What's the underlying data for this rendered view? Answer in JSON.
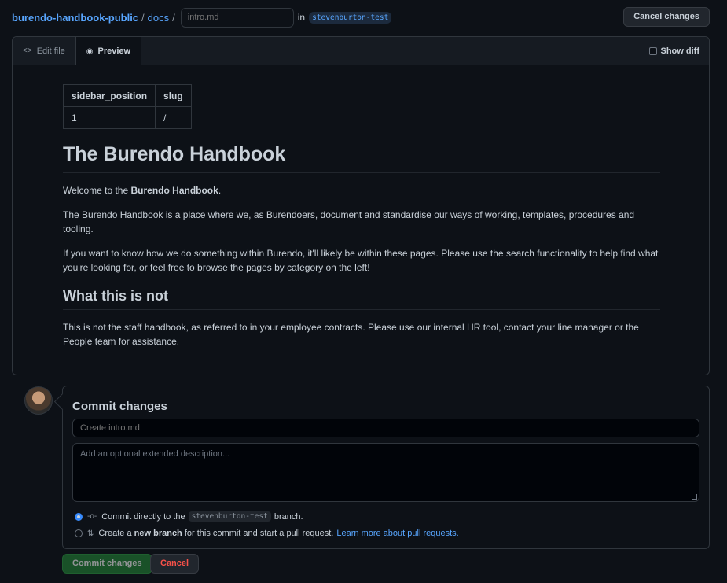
{
  "breadcrumb": {
    "repo": "burendo-handbook-public",
    "sep1": "/",
    "dir": "docs",
    "sep2": "/",
    "filename_placeholder": "intro.md",
    "in_label": "in",
    "branch": "stevenburton-test"
  },
  "header": {
    "cancel_label": "Cancel changes"
  },
  "editor": {
    "tabs": [
      {
        "label": "Edit file",
        "icon": "code-icon"
      },
      {
        "label": "Preview",
        "icon": "eye-icon",
        "active": true
      }
    ],
    "show_diff_label": "Show diff"
  },
  "preview": {
    "frontmatter": {
      "headers": [
        "sidebar_position",
        "slug"
      ],
      "row": [
        "1",
        "/"
      ]
    },
    "title": "The Burendo Handbook",
    "welcome_prefix": "Welcome to the ",
    "welcome_bold": "Burendo Handbook",
    "welcome_suffix": ".",
    "p2": "The Burendo Handbook is a place where we, as Burendoers, document and standardise our ways of working, templates, procedures and tooling.",
    "p3": "If you want to know how we do something within Burendo, it'll likely be within these pages. Please use the search functionality to help find what you're looking for, or feel free to browse the pages by category on the left!",
    "h2": "What this is not",
    "p4": "This is not the staff handbook, as referred to in your employee contracts. Please use our internal HR tool, contact your line manager or the People team for assistance."
  },
  "commit": {
    "title": "Commit changes",
    "message_placeholder": "Create intro.md",
    "description_placeholder": "Add an optional extended description...",
    "option1_prefix": "Commit directly to the",
    "option1_branch": "stevenburton-test",
    "option1_suffix": "branch.",
    "option2_prefix": "Create a",
    "option2_bold": "new branch",
    "option2_suffix": "for this commit and start a pull request.",
    "option2_link": "Learn more about pull requests.",
    "commit_button": "Commit changes",
    "cancel_button": "Cancel"
  },
  "colors": {
    "background": "#0d1117",
    "link": "#58a6ff",
    "primary_button": "#238636",
    "danger": "#f85149"
  }
}
